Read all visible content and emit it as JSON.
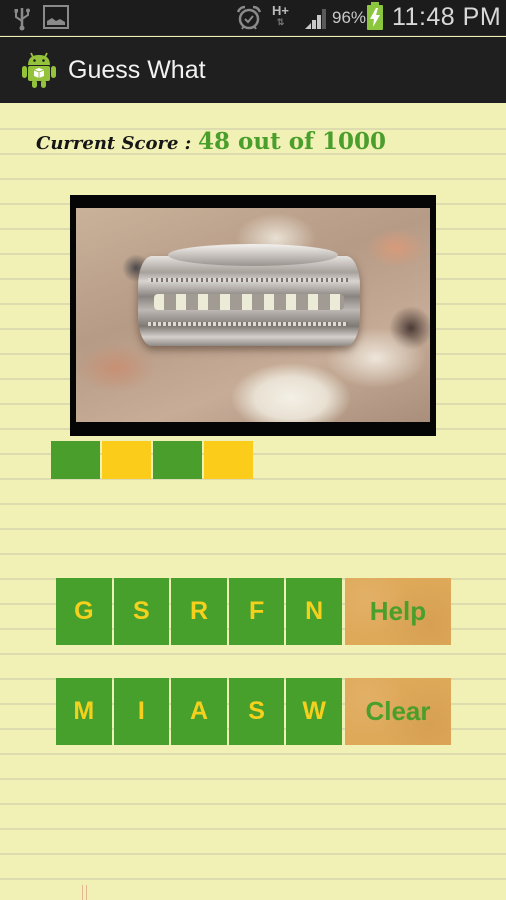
{
  "status_bar": {
    "left_icons": [
      "usb-icon",
      "gallery-icon"
    ],
    "right_icons": [
      "alarm-icon",
      "hplus-network-icon",
      "signal-icon",
      "battery-charging-icon"
    ],
    "network_type": "H+",
    "network_arrows": "⇅",
    "battery_percent": "96%",
    "time": "11:48 PM"
  },
  "action_bar": {
    "app_icon": "android-icon",
    "title": "Guess What"
  },
  "score": {
    "label": "Current Score :",
    "value": "48 out of 1000",
    "current": 48,
    "total": 1000
  },
  "puzzle": {
    "image": "silver-ring-on-seashells-photo",
    "answer_slots": [
      {
        "color": "#4a9e2c",
        "letter": ""
      },
      {
        "color": "#fccc1a",
        "letter": ""
      },
      {
        "color": "#4a9e2c",
        "letter": ""
      },
      {
        "color": "#fccc1a",
        "letter": ""
      }
    ]
  },
  "keyboard": {
    "row1": [
      "G",
      "S",
      "R",
      "F",
      "N"
    ],
    "row2": [
      "M",
      "I",
      "A",
      "S",
      "W"
    ],
    "help_label": "Help",
    "clear_label": "Clear"
  },
  "colors": {
    "tile_green": "#47a02c",
    "tile_letter_yellow": "#f5d01c",
    "action_orange": "#dfa95a",
    "score_green": "#4a9e2c",
    "paper": "#f1f0b5"
  }
}
